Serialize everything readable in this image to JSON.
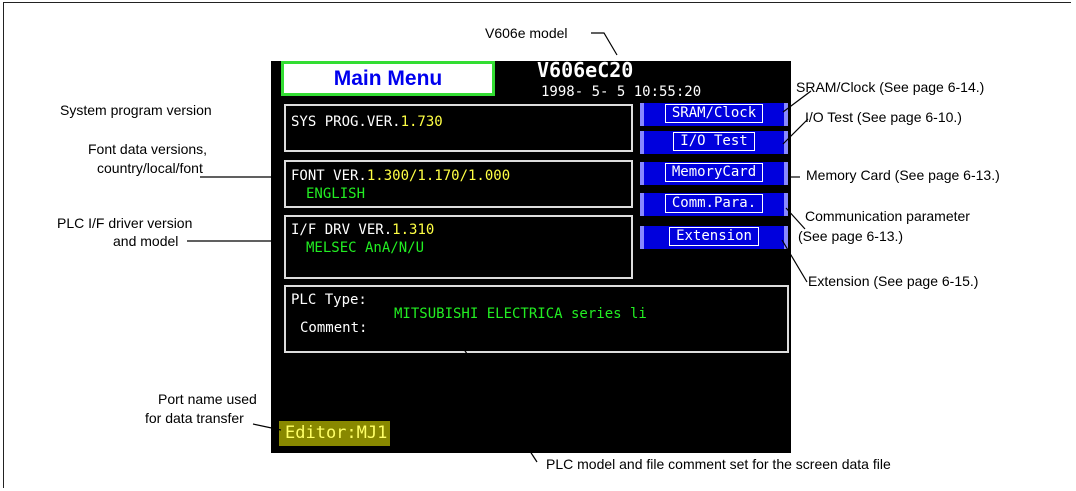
{
  "screen": {
    "title": "Main Menu",
    "model": "V606eC20",
    "datetime": "1998- 5- 5 10:55:20",
    "sys_prog": {
      "label": "SYS PROG.VER.",
      "value": "1.730"
    },
    "font": {
      "label": "FONT VER.",
      "value": "1.300/1.170/1.000",
      "language": "ENGLISH"
    },
    "driver": {
      "label": "I/F DRV VER.",
      "value": "1.310",
      "model": "MELSEC AnA/N/U"
    },
    "plc": {
      "type_label": "PLC Type:",
      "comment_label": "Comment:",
      "comment_value": "MITSUBISHI ELECTRICA series li"
    },
    "buttons": [
      "SRAM/Clock",
      "I/O Test",
      "MemoryCard",
      "Comm.Para.",
      "Extension"
    ],
    "port": "Editor:MJ1"
  },
  "callouts": {
    "model": "V606e model",
    "system_program": "System program version",
    "font_line1": "Font data versions,",
    "font_line2": "country/local/font",
    "driver_line1": "PLC I/F driver version",
    "driver_line2": "and model",
    "port_line1": "Port name used",
    "port_line2": "for data transfer",
    "sram": "SRAM/Clock (See page 6-14.)",
    "io": "I/O Test (See page 6-10.)",
    "memory": "Memory Card (See page 6-13.)",
    "comm_line1": "Communication parameter",
    "comm_line2": "(See page 6-13.)",
    "extension": "Extension (See page 6-15.)",
    "plc_model": "PLC model and file comment set for the screen data file"
  }
}
